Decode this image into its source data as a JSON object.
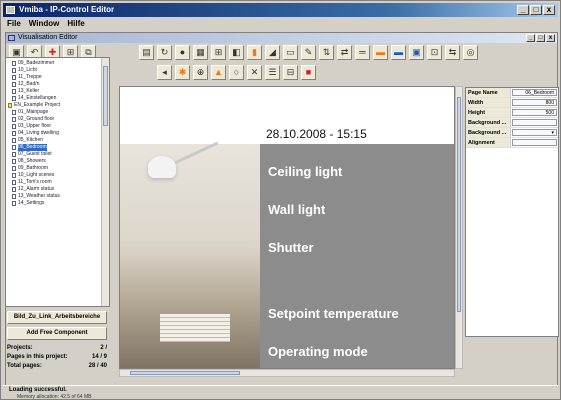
{
  "window": {
    "title": "Vmiba - IP-Control Editor",
    "min": "_",
    "max": "□",
    "close": "x"
  },
  "menubar": [
    "File",
    "Window",
    "Hilfe"
  ],
  "inner_window": {
    "title": "Visualisation Editor"
  },
  "toolbar_left": [
    {
      "icon": "new-icon",
      "glyph": "▣"
    },
    {
      "icon": "undo-icon",
      "glyph": "↶"
    },
    {
      "icon": "pin-icon",
      "glyph": "✚",
      "color": "red"
    },
    {
      "icon": "grid-icon",
      "glyph": "⊞"
    },
    {
      "icon": "copy-icon",
      "glyph": "⧉"
    }
  ],
  "toolbar_row1": [
    {
      "icon": "folder-icon",
      "glyph": "▤"
    },
    {
      "icon": "refresh-icon",
      "glyph": "↻"
    },
    {
      "icon": "record-icon",
      "glyph": "●"
    },
    {
      "icon": "table-icon",
      "glyph": "▦"
    },
    {
      "icon": "grid-add-icon",
      "glyph": "⊞"
    },
    {
      "icon": "button-icon",
      "glyph": "◧"
    },
    {
      "icon": "thermometer-icon",
      "glyph": "▮",
      "color": "orange"
    },
    {
      "icon": "chart-icon",
      "glyph": "◢"
    },
    {
      "icon": "calendar-icon",
      "glyph": "▭"
    },
    {
      "icon": "pen-icon",
      "glyph": "✎"
    },
    {
      "icon": "arrows-icon",
      "glyph": "⇅"
    },
    {
      "icon": "link-icon",
      "glyph": "⇄"
    },
    {
      "icon": "dash-icon",
      "glyph": "═"
    },
    {
      "icon": "bar-icon",
      "glyph": "▬",
      "color": "orange"
    },
    {
      "icon": "monitor-icon",
      "glyph": "▬",
      "color": "blue"
    },
    {
      "icon": "window-icon",
      "glyph": "▣",
      "color": "blue"
    },
    {
      "icon": "image-icon",
      "glyph": "⊡"
    },
    {
      "icon": "share-icon",
      "glyph": "⇆"
    },
    {
      "icon": "target-icon",
      "glyph": "◎"
    }
  ],
  "toolbar_row2": [
    {
      "icon": "arrow-icon",
      "glyph": "◂"
    },
    {
      "icon": "star-icon",
      "glyph": "✱",
      "color": "orange"
    },
    {
      "icon": "zoom-icon",
      "glyph": "⊕"
    },
    {
      "icon": "warning-icon",
      "glyph": "▲",
      "color": "orange"
    },
    {
      "icon": "circle-icon",
      "glyph": "○"
    },
    {
      "icon": "cross-icon",
      "glyph": "✕"
    },
    {
      "icon": "list-icon",
      "glyph": "☰"
    },
    {
      "icon": "minus-box-icon",
      "glyph": "⊟"
    },
    {
      "icon": "stop-icon",
      "glyph": "■",
      "color": "red"
    }
  ],
  "tree": [
    {
      "label": "09_Badezimmer",
      "kind": "page"
    },
    {
      "label": "10_Licht",
      "kind": "page"
    },
    {
      "label": "11_Treppe",
      "kind": "page"
    },
    {
      "label": "12_Bad/n",
      "kind": "page"
    },
    {
      "label": "13_Keller",
      "kind": "page"
    },
    {
      "label": "14_Einstellungen",
      "kind": "page"
    },
    {
      "label": "EN_Example Project",
      "kind": "group"
    },
    {
      "label": "01_Mainpage",
      "kind": "page"
    },
    {
      "label": "02_Ground floor",
      "kind": "page"
    },
    {
      "label": "03_Upper floor",
      "kind": "page"
    },
    {
      "label": "04_Living dwelling",
      "kind": "page"
    },
    {
      "label": "05_Kitchen",
      "kind": "page"
    },
    {
      "label": "06_Bedroom",
      "kind": "page",
      "selected": true
    },
    {
      "label": "07_Guest toilet",
      "kind": "page"
    },
    {
      "label": "08_Showers",
      "kind": "page"
    },
    {
      "label": "09_Bathroom",
      "kind": "page"
    },
    {
      "label": "10_Light scenes",
      "kind": "page"
    },
    {
      "label": "11_Tom's room",
      "kind": "page"
    },
    {
      "label": "12_Alarm status",
      "kind": "page"
    },
    {
      "label": "13_Weather status",
      "kind": "page"
    },
    {
      "label": "14_Settings",
      "kind": "page"
    }
  ],
  "buttons": {
    "delete_label": "Bild_Zu_Link_Arbeitsbereiche",
    "add_label": "Add Free Component"
  },
  "stats": [
    {
      "label": "Projects:",
      "value": "2 /"
    },
    {
      "label": "Pages in this project:",
      "value": "14 / 9"
    },
    {
      "label": "Total pages:",
      "value": "28 / 40"
    }
  ],
  "visualisation": {
    "datetime": "28.10.2008 - 15:15",
    "menu_items": [
      "Ceiling light",
      "Wall light",
      "Shutter",
      "Setpoint temperature",
      "Operating mode"
    ]
  },
  "properties": [
    {
      "key": "Page Name",
      "value": "06_Bedroom"
    },
    {
      "key": "Width",
      "value": "800"
    },
    {
      "key": "Height",
      "value": "500"
    },
    {
      "key": "Background ...",
      "value": ""
    },
    {
      "key": "Background ...",
      "value": "▾"
    },
    {
      "key": "Alignment",
      "value": ""
    }
  ],
  "status": {
    "line1": "Loading successful.",
    "line2": "Memory allocation: 42.5 of 64 MB"
  }
}
